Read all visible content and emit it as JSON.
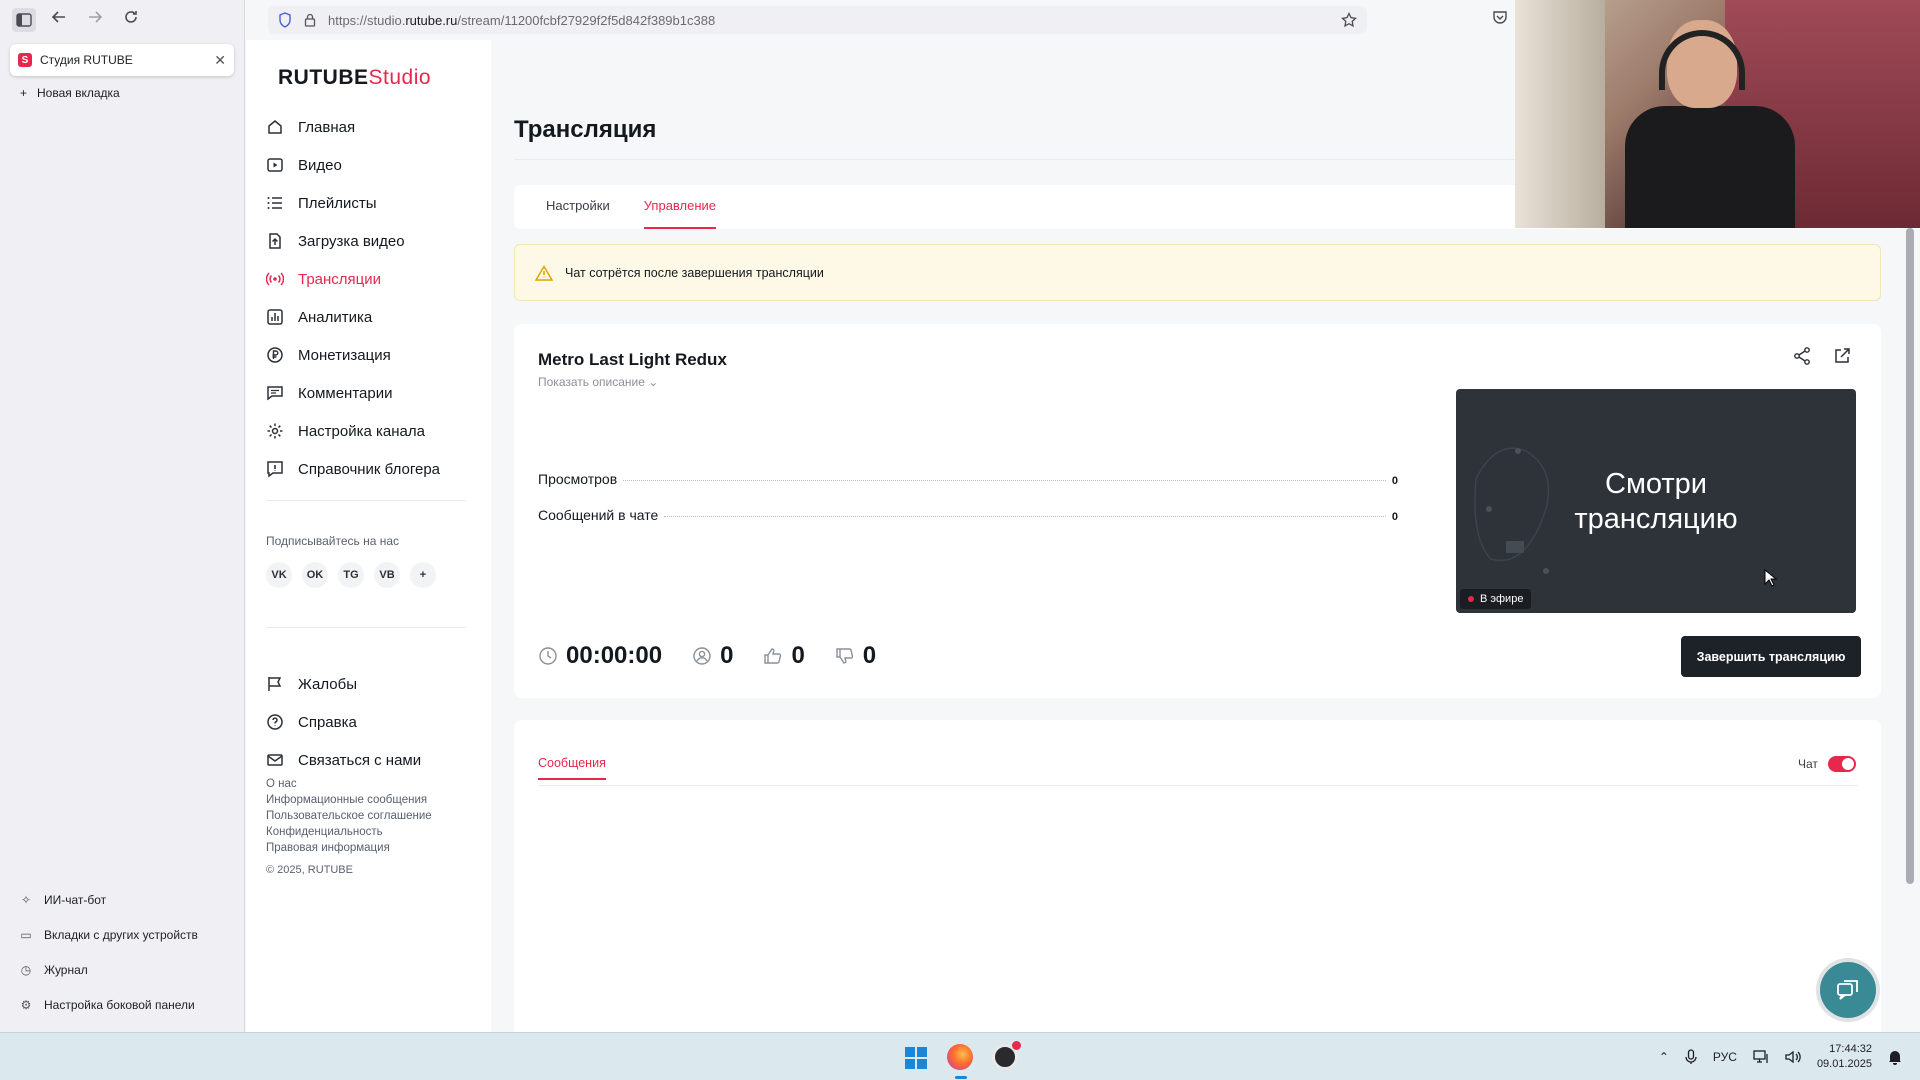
{
  "browser": {
    "url_prefix": "https://studio.",
    "url_domain": "rutube.ru",
    "url_suffix": "/stream/11200fcbf27929f2f5d842f389b1c388",
    "tab_title": "Студия RUTUBE",
    "new_tab": "Новая вкладка",
    "sidebar_bottom": [
      "ИИ-чат-бот",
      "Вкладки с других устройств",
      "Журнал",
      "Настройка боковой панели"
    ]
  },
  "logo": {
    "main": "RUTUBE",
    "sub": "Studio"
  },
  "nav": {
    "items": [
      {
        "label": "Главная",
        "icon": "home-icon"
      },
      {
        "label": "Видео",
        "icon": "video-icon"
      },
      {
        "label": "Плейлисты",
        "icon": "list-icon"
      },
      {
        "label": "Загрузка видео",
        "icon": "upload-icon"
      },
      {
        "label": "Трансляции",
        "icon": "broadcast-icon",
        "active": true
      },
      {
        "label": "Аналитика",
        "icon": "analytics-icon"
      },
      {
        "label": "Монетизация",
        "icon": "ruble-icon"
      },
      {
        "label": "Комментарии",
        "icon": "comment-icon"
      },
      {
        "label": "Настройка канала",
        "icon": "gear-icon"
      },
      {
        "label": "Справочник блогера",
        "icon": "info-icon"
      }
    ],
    "subscribe_label": "Подписывайтесь на нас",
    "socials": [
      "VK",
      "OK",
      "TG",
      "VB",
      "+"
    ],
    "secondary": [
      {
        "label": "Жалобы",
        "icon": "flag-icon"
      },
      {
        "label": "Справка",
        "icon": "help-icon"
      },
      {
        "label": "Связаться с нами",
        "icon": "mail-icon"
      }
    ],
    "footer_links": [
      "О нас",
      "Информационные сообщения",
      "Пользовательское соглашение",
      "Конфиденциальность",
      "Правовая информация"
    ],
    "copyright": "© 2025, RUTUBE"
  },
  "page": {
    "title": "Трансляция",
    "tabs": [
      "Настройки",
      "Управление"
    ],
    "active_tab": "Управление",
    "warning": "Чат сотрётся после завершения трансляции"
  },
  "stream": {
    "title": "Metro Last Light Redux",
    "show_description": "Показать описание",
    "stats": [
      {
        "label": "Просмотров",
        "value": "0"
      },
      {
        "label": "Сообщений в чате",
        "value": "0"
      }
    ],
    "duration": "00:00:00",
    "viewers": "0",
    "likes": "0",
    "dislikes": "0",
    "preview_line1": "Смотри",
    "preview_line2": "трансляцию",
    "live_label": "В эфире",
    "end_button": "Завершить трансляцию"
  },
  "chat": {
    "tab": "Сообщения",
    "toggle_label": "Чат",
    "enabled": true
  },
  "taskbar": {
    "lang": "РУС",
    "time": "17:44:32",
    "date": "09.01.2025"
  },
  "colors": {
    "accent": "#e6284d",
    "dark_button": "#1d2228"
  }
}
